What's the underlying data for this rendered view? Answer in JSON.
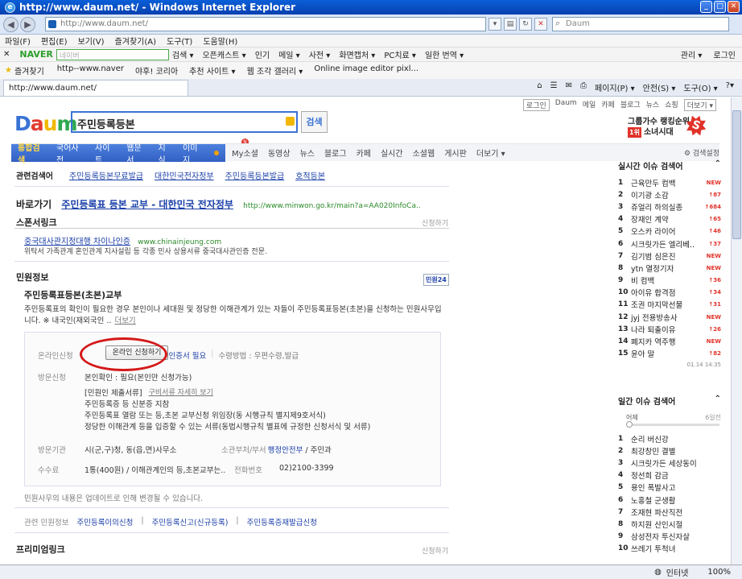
{
  "window": {
    "title": "http://www.daum.net/ - Windows Internet Explorer"
  },
  "address": {
    "url": "http://www.daum.net/",
    "search_placeholder": "Daum"
  },
  "menu": [
    "파일(F)",
    "편집(E)",
    "보기(V)",
    "즐겨찾기(A)",
    "도구(T)",
    "도움말(H)"
  ],
  "naver_toolbar": {
    "brand": "NAVER",
    "placeholder": "네이버",
    "items": [
      "검색 ▾",
      "오픈캐스트 ▾",
      "인기",
      "메일 ▾",
      "사전 ▾",
      "화면캡처 ▾",
      "PC치료 ▾",
      "일한 번역 ▾"
    ],
    "right": [
      "관리 ▾",
      "로그인"
    ]
  },
  "favorites": {
    "label": "즐겨찾기",
    "items": [
      "http--www.naver",
      "야후! 코리아",
      "추천 사이트 ▾",
      "웹 조각 갤러리 ▾",
      "Online image editor pixl..."
    ]
  },
  "tab": {
    "title": "http://www.daum.net/"
  },
  "tools": [
    "페이지(P) ▾",
    "안전(S) ▾",
    "도구(O) ▾",
    "?▾"
  ],
  "daum": {
    "toplinks": [
      "로그인",
      "Daum",
      "메일",
      "카페",
      "블로그",
      "뉴스",
      "쇼핑",
      "더보기 ▾"
    ],
    "logo": {
      "d": "D",
      "a": "a",
      "u": "u",
      "m": "m"
    },
    "query": "주민등록등본",
    "search_button": "검색",
    "rank": {
      "title": "그룹가수 랭킹순위",
      "badge": "1위",
      "name": "소녀시대"
    },
    "tabs_left": [
      "통합검색",
      "국어사전",
      "사이트",
      "웹문서",
      "지식",
      "이미지"
    ],
    "tabs_right": [
      "My소셜",
      "동영상",
      "뉴스",
      "블로그",
      "카페",
      "실시간",
      "소셜웹",
      "게시판",
      "더보기 ▾"
    ],
    "search_options": "⚙ 검색설정",
    "related": {
      "label": "관련검색어",
      "items": [
        "주민등록등본무료발급",
        "대한민국전자정부",
        "주민등록등본발급",
        "호적등본"
      ]
    },
    "direct": {
      "label": "바로가기",
      "link": "주민등록표 등본 교부 - 대한민국 전자정부",
      "url": "http://www.minwon.go.kr/main?a=AA020InfoCa.."
    },
    "sponsor": {
      "title": "스폰서링크",
      "apply": "신청하기",
      "ad_title": "중국대사관지정대행 차이나인증",
      "ad_url": "www.chinainjeung.com",
      "ad_desc": "위탁서 가족관계 혼인관계 지사설립 등 각종 민사 상용서류 중국대사관인증 전문."
    },
    "minwon": {
      "title": "민원정보",
      "logo": "민원24",
      "item_title": "주민등록표등본(초본)교부",
      "desc": "주민등록표의 확인이 필요한 경우 본인이나 세대원 및 정당한 이해관계가 있는 자들이 주민등록표등본(초본)을 신청하는 민원사무입니다. ※ 내국인(재외국인 ..",
      "more": "더보기",
      "online_label": "온라인신청",
      "online_button": "온라인 신청하기",
      "online_tail": "공인 인증서 필요",
      "receive": "수령방법 : 우편수령,발급",
      "visit_label": "방문신청",
      "visit_value": "본인확인 : 필요(본인만 신청가능)",
      "docs_title": "[민원인 제출서류]",
      "docs_link": "구비서류 자세히 보기",
      "docs": [
        "주민등록증 등 신분증 지참",
        "주민등록표 열람 또는 등,초본 교부신청 위임장(동 시행규칙 별지제9호서식)",
        "정당한 이해관계 등을 입증할 수 있는 서류(동법시행규칙 별표에 규정한 신청서식 및 서류)"
      ],
      "agency_label": "방문기관",
      "agency_value": "시(군,구)청, 동(읍,면)사무소",
      "dept_label": "소관부처/부서",
      "dept_link": "행정안전부",
      "dept_tail": "/ 주민과",
      "fee_label": "수수료",
      "fee_value": "1통(400원) / 이해관계인의 등,초본교부는..",
      "tel_label": "전화번호",
      "tel_value": "02)2100-3399",
      "notice": "민원사무의 내용은 업데이트로 인해 변경될 수 있습니다.",
      "rel_label": "관련 민원정보",
      "rel_items": [
        "주민등록이의신청",
        "주민등록신고(신규등록)",
        "주민등록증재발급신청"
      ]
    },
    "premium": {
      "title": "프리미엄링크",
      "apply": "신청하기"
    },
    "issues": {
      "title": "실시간 이슈 검색어",
      "time": "01.14  14:35",
      "items": [
        {
          "n": "1",
          "t": "근육만두 컴백",
          "r": "NEW"
        },
        {
          "n": "2",
          "t": "이기광 소감",
          "r": "↑87"
        },
        {
          "n": "3",
          "t": "쥬얼리 하의실종",
          "r": "↑684"
        },
        {
          "n": "4",
          "t": "장재인 계약",
          "r": "↑65"
        },
        {
          "n": "5",
          "t": "오스카 라이어",
          "r": "↑46"
        },
        {
          "n": "6",
          "t": "시크릿가든 엘리베..",
          "r": "↑37"
        },
        {
          "n": "7",
          "t": "김기범 심은진",
          "r": "NEW"
        },
        {
          "n": "8",
          "t": "ytn 열정기자",
          "r": "NEW"
        },
        {
          "n": "9",
          "t": "비 컴백",
          "r": "↑36"
        },
        {
          "n": "10",
          "t": "아이유 합격점",
          "r": "↑34"
        },
        {
          "n": "11",
          "t": "조권 마지막선물",
          "r": "↑31"
        },
        {
          "n": "12",
          "t": "jyj 전용방송사",
          "r": "NEW"
        },
        {
          "n": "13",
          "t": "나라 퇴출이유",
          "r": "↑26"
        },
        {
          "n": "14",
          "t": "폐지카 역주행",
          "r": "NEW"
        },
        {
          "n": "15",
          "t": "윤아 말",
          "r": "↑82"
        }
      ]
    },
    "daily": {
      "title": "일간 이슈 검색어",
      "from": "어제",
      "to": "6일전",
      "items": [
        "순리 버신강",
        "최강창민 결별",
        "시크릿가든 세상동이",
        "정선희 감금",
        "용인 폭발사고",
        "노홍철 군생활",
        "조재현 파산직전",
        "하지원 산인시절",
        "삼성전자 투신자살",
        "쓰레기 투척녀"
      ]
    }
  },
  "status": {
    "zone": "인터넷",
    "zoom": "100%"
  }
}
